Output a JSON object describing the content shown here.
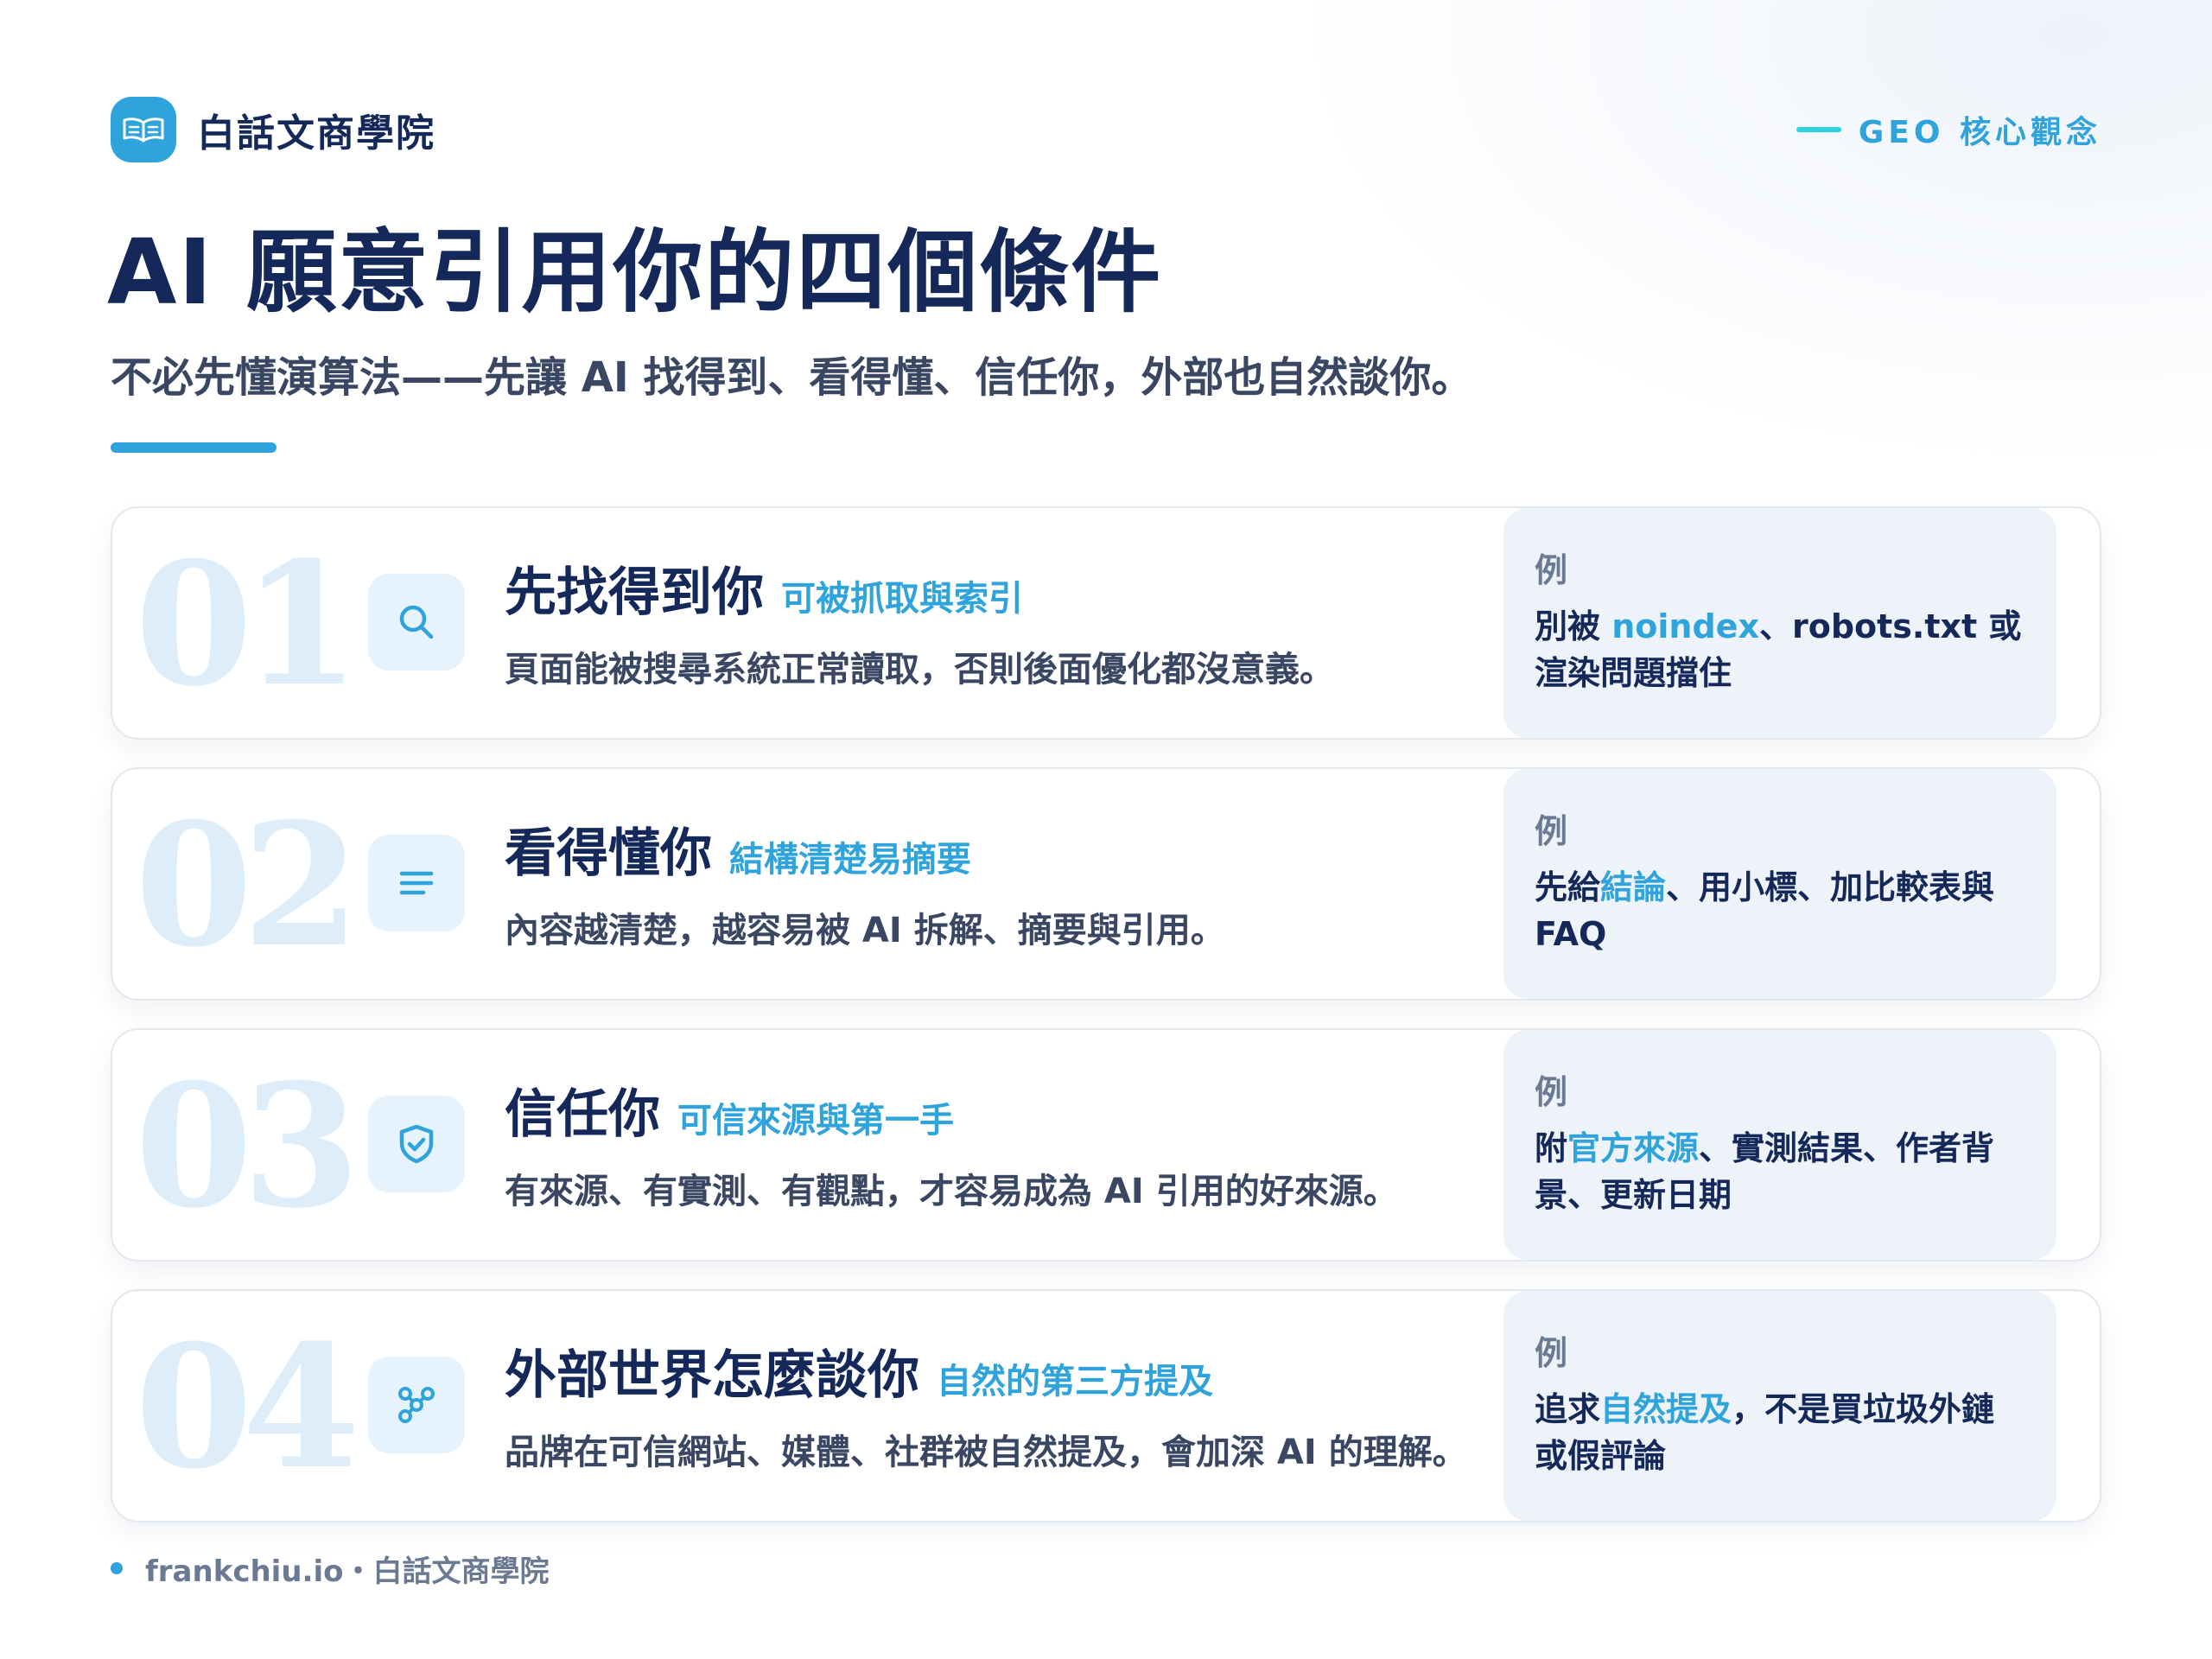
{
  "brand": {
    "name": "白話文商學院"
  },
  "topic": {
    "label": "GEO 核心觀念"
  },
  "title": "AI 願意引用你的四個條件",
  "subtitle": "不必先懂演算法——先讓 AI 找得到、看得懂、信任你，外部也自然談你。",
  "cards": [
    {
      "number": "01",
      "icon": "search-icon",
      "title": "先找得到你",
      "tag": "可被抓取與索引",
      "desc": "頁面能被搜尋系統正常讀取，否則後面優化都沒意義。",
      "example_label": "例",
      "example": {
        "pre": "別被 ",
        "hl": "noindex",
        "post": "、robots.txt 或渲染問題擋住"
      }
    },
    {
      "number": "02",
      "icon": "lines-icon",
      "title": "看得懂你",
      "tag": "結構清楚易摘要",
      "desc": "內容越清楚，越容易被 AI 拆解、摘要與引用。",
      "example_label": "例",
      "example": {
        "pre": "先給",
        "hl": "結論",
        "post": "、用小標、加比較表與 FAQ"
      }
    },
    {
      "number": "03",
      "icon": "shield-check-icon",
      "title": "信任你",
      "tag": "可信來源與第一手",
      "desc": "有來源、有實測、有觀點，才容易成為 AI 引用的好來源。",
      "example_label": "例",
      "example": {
        "pre": "附",
        "hl": "官方來源",
        "post": "、實測結果、作者背景、更新日期"
      }
    },
    {
      "number": "04",
      "icon": "network-icon",
      "title": "外部世界怎麼談你",
      "tag": "自然的第三方提及",
      "desc": "品牌在可信網站、媒體、社群被自然提及，會加深 AI 的理解。",
      "example_label": "例",
      "example": {
        "pre": "追求",
        "hl": "自然提及",
        "post": "，不是買垃圾外鏈或假評論"
      }
    }
  ],
  "footer": {
    "text": "frankchiu.io・白話文商學院"
  },
  "colors": {
    "navy": "#14295a",
    "accent": "#2ea3dc",
    "cyan": "#2ed3e0",
    "number": "#ddeefa",
    "example_bg": "#eef2f9"
  }
}
